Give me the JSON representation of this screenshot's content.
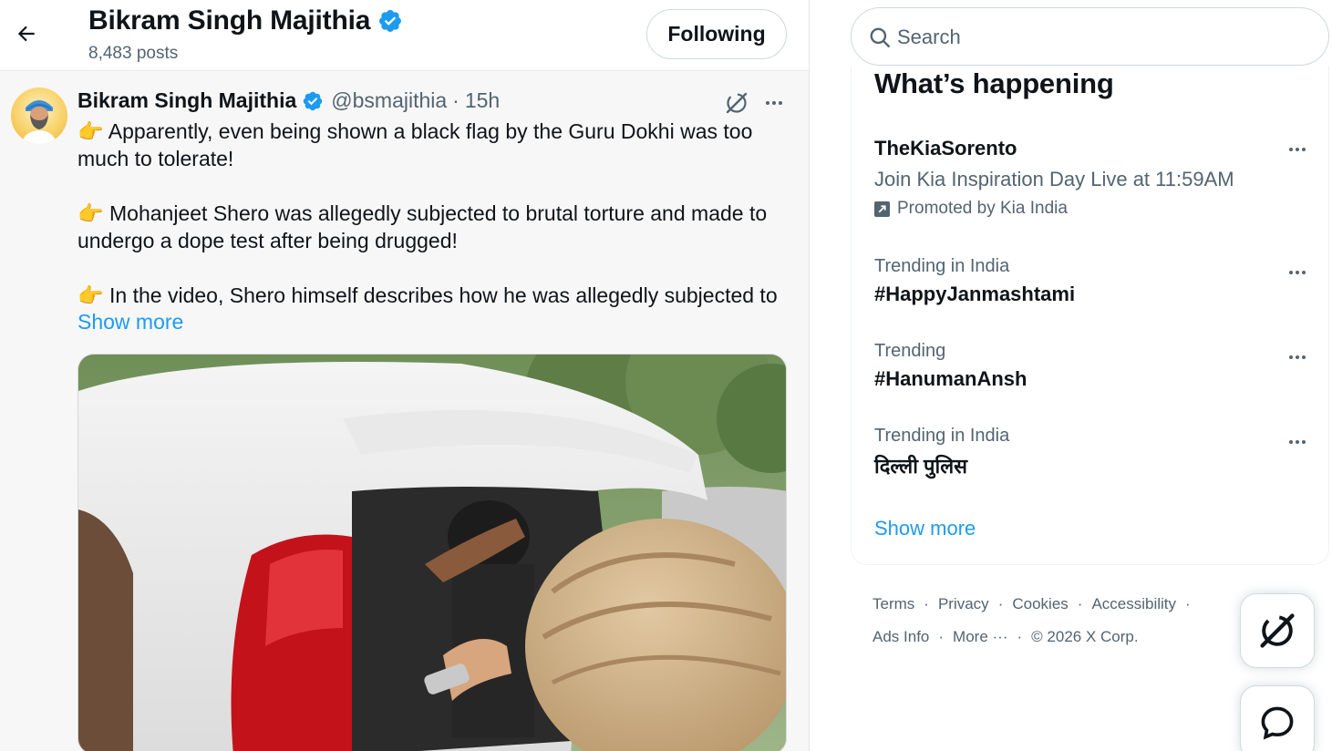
{
  "header": {
    "profile_name": "Bikram Singh Majithia",
    "posts_count": "8,483 posts",
    "following_label": "Following",
    "back_icon": "arrow-left-icon",
    "verified_icon": "verified-badge-icon"
  },
  "tweet": {
    "author": "Bikram Singh Majithia",
    "handle": "@bsmajithia",
    "separator": "·",
    "time": "15h",
    "paragraphs": [
      "👉 Apparently, even being shown a black flag by the Guru Dokhi was too much to tolerate!",
      "👉 Mohanjeet Shero was allegedly subjected to brutal torture and made to undergo a dope test after being drugged!",
      "👉 In the video, Shero himself describes how he was allegedly subjected to"
    ],
    "show_more": "Show more",
    "grok_icon": "grok-icon",
    "more_icon": "more-dots-icon"
  },
  "search": {
    "placeholder": "Search",
    "icon": "search-icon"
  },
  "trends": {
    "title": "What’s happening",
    "promoted": {
      "name": "TheKiaSorento",
      "description": "Join Kia Inspiration Day Live at 11:59AM",
      "promoted_by": "Promoted by Kia India"
    },
    "items": [
      {
        "context": "Trending in India",
        "name": "#HappyJanmashtami"
      },
      {
        "context": "Trending",
        "name": "#HanumanAnsh"
      },
      {
        "context": "Trending in India",
        "name": "दिल्ली पुलिस"
      }
    ],
    "show_more": "Show more"
  },
  "footer": {
    "row1": [
      "Terms",
      "Privacy",
      "Cookies",
      "Accessibility"
    ],
    "row2": [
      "Ads Info",
      "More ···"
    ],
    "copyright": "© 2026 X Corp.",
    "dot": "·"
  },
  "colors": {
    "accent": "#1d9bf0",
    "text_primary": "#0f1419",
    "text_secondary": "#536471",
    "verified": "#1d9bf0"
  }
}
